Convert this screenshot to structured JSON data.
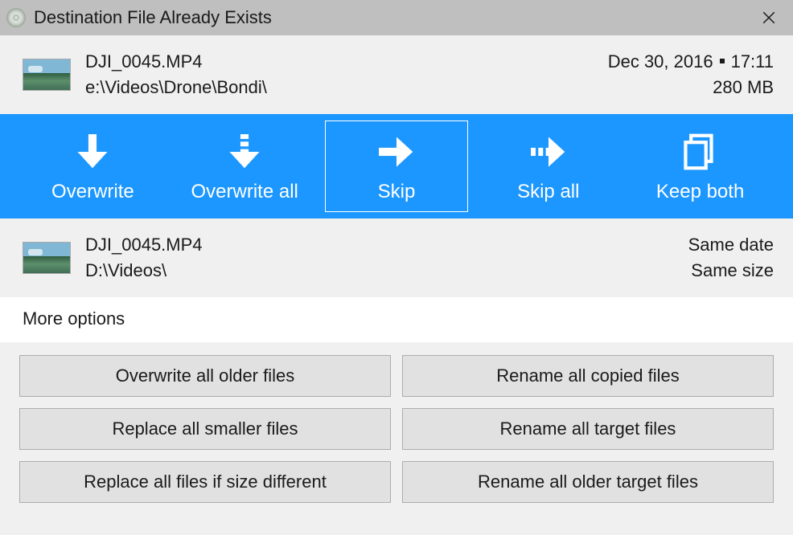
{
  "titlebar": {
    "title": "Destination File Already Exists"
  },
  "source": {
    "filename": "DJI_0045.MP4",
    "path": "e:\\Videos\\Drone\\Bondi\\",
    "date": "Dec 30, 2016",
    "time": "17:11",
    "size": "280 MB"
  },
  "actions": {
    "overwrite": "Overwrite",
    "overwrite_all": "Overwrite all",
    "skip": "Skip",
    "skip_all": "Skip all",
    "keep_both": "Keep both"
  },
  "destination": {
    "filename": "DJI_0045.MP4",
    "path": "D:\\Videos\\",
    "date_status": "Same date",
    "size_status": "Same size"
  },
  "more_options_label": "More options",
  "options": {
    "overwrite_older": "Overwrite all older files",
    "replace_smaller": "Replace all smaller files",
    "replace_diff_size": "Replace all files if size different",
    "rename_copied": "Rename all copied files",
    "rename_target": "Rename all target files",
    "rename_older_target": "Rename all older target files"
  }
}
